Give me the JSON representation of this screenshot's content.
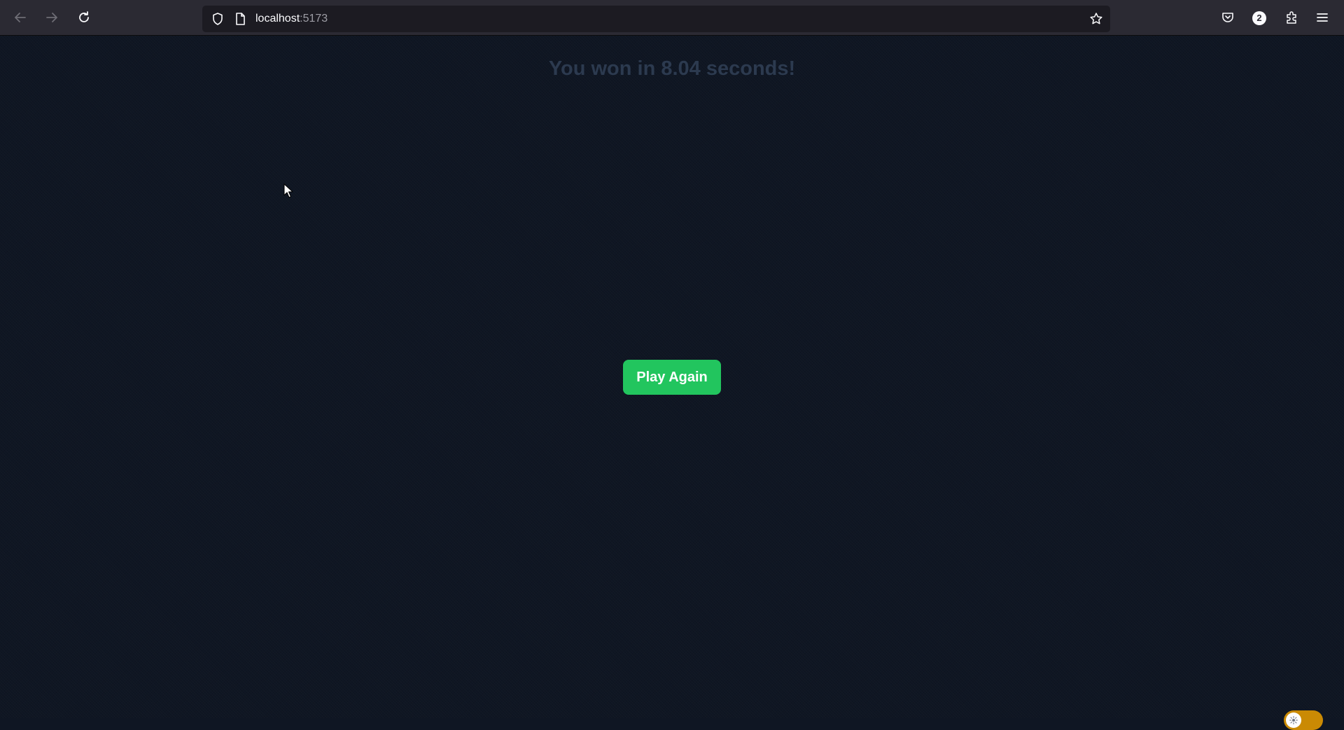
{
  "browser": {
    "url_host": "localhost",
    "url_port": ":5173",
    "extension_badge_count": "2",
    "icons": [
      "back-icon",
      "forward-icon",
      "reload-icon",
      "shield-icon",
      "page-icon",
      "star-icon",
      "pocket-icon",
      "extensions-icon",
      "menu-icon"
    ]
  },
  "page": {
    "win_message": "You won in 8.04 seconds!",
    "play_again_label": "Play Again",
    "theme_toggle": "sun-icon"
  },
  "colors": {
    "background": "#0f1623",
    "title_text": "#2c3a4f",
    "play_button": "#22c55e",
    "toggle": "#ca8a04"
  }
}
